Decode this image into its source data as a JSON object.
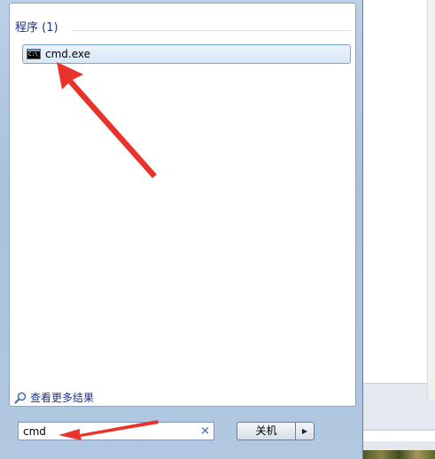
{
  "programs_section": {
    "header": "程序 (1)"
  },
  "results": [
    {
      "label": "cmd.exe",
      "icon": "cmd-console-icon",
      "icon_text": "C:\\"
    }
  ],
  "see_more": {
    "label": "查看更多结果",
    "icon": "search-icon"
  },
  "search": {
    "value": "cmd",
    "clear_glyph": "×"
  },
  "shutdown": {
    "label": "关机",
    "arrow_glyph": "▶"
  },
  "colors": {
    "header_text": "#1e3287",
    "annotation_red": "#e8322a",
    "highlight_border": "#7da2ce"
  }
}
